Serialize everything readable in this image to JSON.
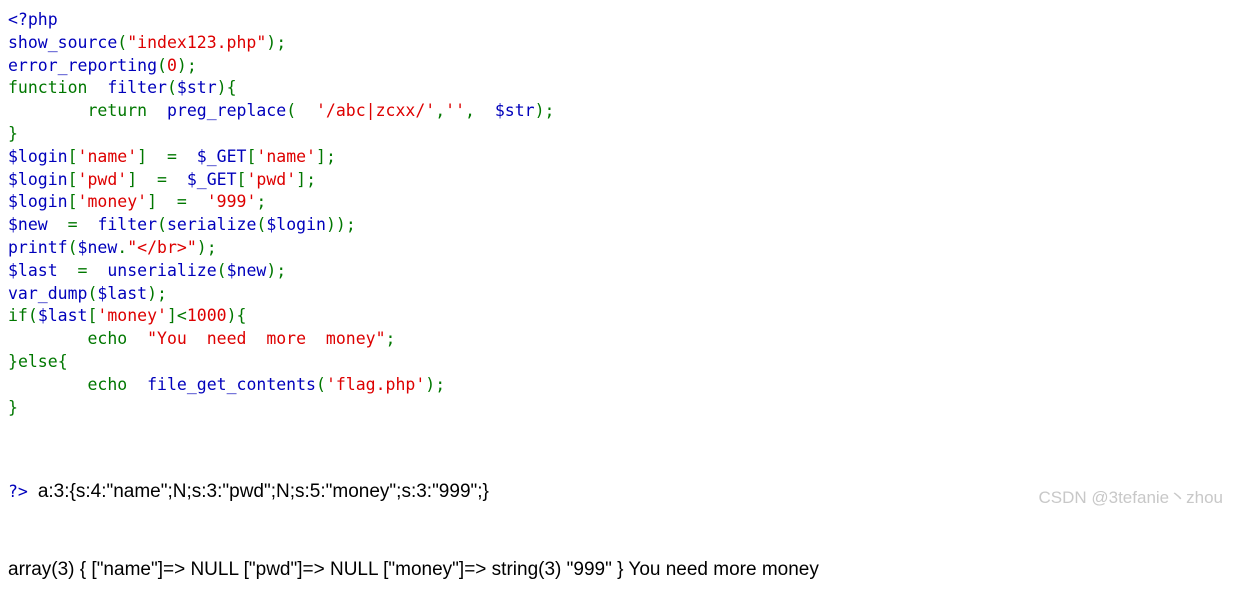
{
  "page": {
    "background_color": "#ffffff",
    "kind": "php-show-source-output"
  },
  "palette": {
    "php_tag": "#0000BB",
    "variable": "#0000BB",
    "function_name": "#0000BB",
    "keyword": "#007700",
    "string": "#DD0000",
    "number": "#DD0000",
    "comment": "#FF8000",
    "output_text": "#000000",
    "watermark": "#c8c8c8"
  },
  "source_listing": {
    "open_tag": "<?php",
    "close_tag": "?>",
    "lines": [
      {
        "n": 1,
        "tokens": [
          {
            "t": "<?php",
            "c": "tag"
          }
        ]
      },
      {
        "n": 2,
        "tokens": [
          {
            "t": "show_source",
            "c": "fn"
          },
          {
            "t": "(",
            "c": "kw"
          },
          {
            "t": "\"index123.php\"",
            "c": "str"
          },
          {
            "t": ")",
            "c": "kw"
          },
          {
            "t": ";",
            "c": "kw"
          }
        ]
      },
      {
        "n": 3,
        "tokens": [
          {
            "t": "error_reporting",
            "c": "fn"
          },
          {
            "t": "(",
            "c": "kw"
          },
          {
            "t": "0",
            "c": "str"
          },
          {
            "t": ")",
            "c": "kw"
          },
          {
            "t": ";",
            "c": "kw"
          }
        ]
      },
      {
        "n": 4,
        "tokens": [
          {
            "t": "function",
            "c": "kw"
          },
          {
            "t": "  ",
            "c": "kw"
          },
          {
            "t": "filter",
            "c": "fn"
          },
          {
            "t": "(",
            "c": "kw"
          },
          {
            "t": "$str",
            "c": "var"
          },
          {
            "t": ")",
            "c": "kw"
          },
          {
            "t": "{",
            "c": "kw"
          }
        ]
      },
      {
        "n": 5,
        "tokens": [
          {
            "t": "        ",
            "c": "kw"
          },
          {
            "t": "return",
            "c": "kw"
          },
          {
            "t": "  ",
            "c": "kw"
          },
          {
            "t": "preg_replace",
            "c": "fn"
          },
          {
            "t": "(  ",
            "c": "kw"
          },
          {
            "t": "'/abc|zcxx/'",
            "c": "str"
          },
          {
            "t": ",",
            "c": "kw"
          },
          {
            "t": "''",
            "c": "str"
          },
          {
            "t": ",  ",
            "c": "kw"
          },
          {
            "t": "$str",
            "c": "var"
          },
          {
            "t": ")",
            "c": "kw"
          },
          {
            "t": ";",
            "c": "kw"
          }
        ]
      },
      {
        "n": 6,
        "tokens": [
          {
            "t": "}",
            "c": "kw"
          }
        ]
      },
      {
        "n": 7,
        "tokens": [
          {
            "t": "$login",
            "c": "var"
          },
          {
            "t": "[",
            "c": "kw"
          },
          {
            "t": "'name'",
            "c": "str"
          },
          {
            "t": "]",
            "c": "kw"
          },
          {
            "t": "  ",
            "c": "kw"
          },
          {
            "t": "=",
            "c": "kw"
          },
          {
            "t": "  ",
            "c": "kw"
          },
          {
            "t": "$_GET",
            "c": "var"
          },
          {
            "t": "[",
            "c": "kw"
          },
          {
            "t": "'name'",
            "c": "str"
          },
          {
            "t": "]",
            "c": "kw"
          },
          {
            "t": ";",
            "c": "kw"
          }
        ]
      },
      {
        "n": 8,
        "tokens": [
          {
            "t": "$login",
            "c": "var"
          },
          {
            "t": "[",
            "c": "kw"
          },
          {
            "t": "'pwd'",
            "c": "str"
          },
          {
            "t": "]",
            "c": "kw"
          },
          {
            "t": "  ",
            "c": "kw"
          },
          {
            "t": "=",
            "c": "kw"
          },
          {
            "t": "  ",
            "c": "kw"
          },
          {
            "t": "$_GET",
            "c": "var"
          },
          {
            "t": "[",
            "c": "kw"
          },
          {
            "t": "'pwd'",
            "c": "str"
          },
          {
            "t": "]",
            "c": "kw"
          },
          {
            "t": ";",
            "c": "kw"
          }
        ]
      },
      {
        "n": 9,
        "tokens": [
          {
            "t": "$login",
            "c": "var"
          },
          {
            "t": "[",
            "c": "kw"
          },
          {
            "t": "'money'",
            "c": "str"
          },
          {
            "t": "]",
            "c": "kw"
          },
          {
            "t": "  ",
            "c": "kw"
          },
          {
            "t": "=",
            "c": "kw"
          },
          {
            "t": "  ",
            "c": "kw"
          },
          {
            "t": "'999'",
            "c": "str"
          },
          {
            "t": ";",
            "c": "kw"
          }
        ]
      },
      {
        "n": 10,
        "tokens": [
          {
            "t": "$new",
            "c": "var"
          },
          {
            "t": "  ",
            "c": "kw"
          },
          {
            "t": "=",
            "c": "kw"
          },
          {
            "t": "  ",
            "c": "kw"
          },
          {
            "t": "filter",
            "c": "fn"
          },
          {
            "t": "(",
            "c": "kw"
          },
          {
            "t": "serialize",
            "c": "fn"
          },
          {
            "t": "(",
            "c": "kw"
          },
          {
            "t": "$login",
            "c": "var"
          },
          {
            "t": "))",
            "c": "kw"
          },
          {
            "t": ";",
            "c": "kw"
          }
        ]
      },
      {
        "n": 11,
        "tokens": [
          {
            "t": "printf",
            "c": "fn"
          },
          {
            "t": "(",
            "c": "kw"
          },
          {
            "t": "$new",
            "c": "var"
          },
          {
            "t": ".",
            "c": "kw"
          },
          {
            "t": "\"</br>\"",
            "c": "str"
          },
          {
            "t": ")",
            "c": "kw"
          },
          {
            "t": ";",
            "c": "kw"
          }
        ]
      },
      {
        "n": 12,
        "tokens": [
          {
            "t": "$last",
            "c": "var"
          },
          {
            "t": "  ",
            "c": "kw"
          },
          {
            "t": "=",
            "c": "kw"
          },
          {
            "t": "  ",
            "c": "kw"
          },
          {
            "t": "unserialize",
            "c": "fn"
          },
          {
            "t": "(",
            "c": "kw"
          },
          {
            "t": "$new",
            "c": "var"
          },
          {
            "t": ")",
            "c": "kw"
          },
          {
            "t": ";",
            "c": "kw"
          }
        ]
      },
      {
        "n": 13,
        "tokens": [
          {
            "t": "var_dump",
            "c": "fn"
          },
          {
            "t": "(",
            "c": "kw"
          },
          {
            "t": "$last",
            "c": "var"
          },
          {
            "t": ")",
            "c": "kw"
          },
          {
            "t": ";",
            "c": "kw"
          }
        ]
      },
      {
        "n": 14,
        "tokens": [
          {
            "t": "if",
            "c": "kw"
          },
          {
            "t": "(",
            "c": "kw"
          },
          {
            "t": "$last",
            "c": "var"
          },
          {
            "t": "[",
            "c": "kw"
          },
          {
            "t": "'money'",
            "c": "str"
          },
          {
            "t": "]",
            "c": "kw"
          },
          {
            "t": "<",
            "c": "kw"
          },
          {
            "t": "1000",
            "c": "str"
          },
          {
            "t": ")",
            "c": "kw"
          },
          {
            "t": "{",
            "c": "kw"
          }
        ]
      },
      {
        "n": 15,
        "tokens": [
          {
            "t": "        ",
            "c": "kw"
          },
          {
            "t": "echo",
            "c": "kw"
          },
          {
            "t": "  ",
            "c": "kw"
          },
          {
            "t": "\"You  need  more  money\"",
            "c": "str"
          },
          {
            "t": ";",
            "c": "kw"
          }
        ]
      },
      {
        "n": 16,
        "tokens": [
          {
            "t": "}",
            "c": "kw"
          },
          {
            "t": "else",
            "c": "kw"
          },
          {
            "t": "{",
            "c": "kw"
          }
        ]
      },
      {
        "n": 17,
        "tokens": [
          {
            "t": "        ",
            "c": "kw"
          },
          {
            "t": "echo",
            "c": "kw"
          },
          {
            "t": "  ",
            "c": "kw"
          },
          {
            "t": "file_get_contents",
            "c": "fn"
          },
          {
            "t": "(",
            "c": "kw"
          },
          {
            "t": "'flag.php'",
            "c": "str"
          },
          {
            "t": ")",
            "c": "kw"
          },
          {
            "t": ";",
            "c": "kw"
          }
        ]
      },
      {
        "n": 18,
        "tokens": [
          {
            "t": "}",
            "c": "kw"
          }
        ]
      }
    ]
  },
  "program_output": {
    "close_tag": "?>",
    "serialized_line": "a:3:{s:4:\"name\";N;s:3:\"pwd\";N;s:5:\"money\";s:3:\"999\";}",
    "var_dump_line": "array(3) { [\"name\"]=> NULL [\"pwd\"]=> NULL [\"money\"]=> string(3) \"999\" } You need more money"
  },
  "watermark": {
    "text": "CSDN @3tefanie丶zhou"
  }
}
